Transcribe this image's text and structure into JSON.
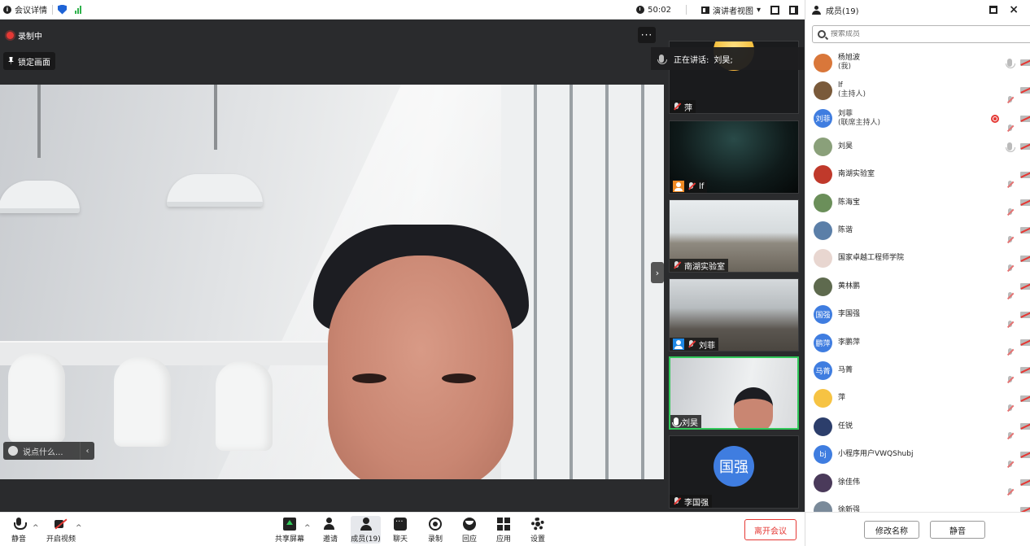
{
  "topbar": {
    "meeting_details": "会议详情",
    "timer": "50:02",
    "view_mode": "演讲者视图"
  },
  "stage": {
    "recording": "录制中",
    "lock_view": "锁定画面",
    "more": "···",
    "chat_placeholder": "说点什么...",
    "speaking_prefix": "正在讲话:",
    "speaking_name": "刘昊;"
  },
  "thumbnails": [
    {
      "name": "萍",
      "type": "cartoon"
    },
    {
      "name": "lf",
      "type": "dark"
    },
    {
      "name": "南湖实验室",
      "type": "room"
    },
    {
      "name": "刘菲",
      "type": "room2"
    },
    {
      "name": "刘昊",
      "type": "self",
      "active": true
    },
    {
      "name": "李国强",
      "type": "avatar",
      "initials": "国强"
    }
  ],
  "toolbar": {
    "mute": "静音",
    "start_video": "开启视频",
    "share_screen": "共享屏幕",
    "invite": "邀请",
    "members": "成员(19)",
    "chat": "聊天",
    "record": "录制",
    "react": "回应",
    "apps": "应用",
    "settings": "设置",
    "leave": "离开会议"
  },
  "panel": {
    "title": "成员(19)",
    "search_placeholder": "搜索成员",
    "rename": "修改名称",
    "mute": "静音",
    "members": [
      {
        "name": "杨旭波",
        "role": "(我)",
        "avatar_color": "#d9773a",
        "initials": ""
      },
      {
        "name": "lf",
        "role": "(主持人)",
        "avatar_color": "#7a5a3a",
        "initials": ""
      },
      {
        "name": "刘菲",
        "role": "(联席主持人)",
        "avatar_color": "#3f7de0",
        "initials": "刘菲",
        "recording": true
      },
      {
        "name": "刘昊",
        "role": "",
        "avatar_color": "#8aa07a",
        "initials": ""
      },
      {
        "name": "南湖实验室",
        "role": "",
        "avatar_color": "#c0392b",
        "initials": ""
      },
      {
        "name": "陈海宝",
        "role": "",
        "avatar_color": "#6b8f5a",
        "initials": ""
      },
      {
        "name": "陈谐",
        "role": "",
        "avatar_color": "#5b7fa8",
        "initials": ""
      },
      {
        "name": "国家卓越工程师学院",
        "role": "",
        "avatar_color": "#e8d6d0",
        "initials": ""
      },
      {
        "name": "黄林鹏",
        "role": "",
        "avatar_color": "#5e6a4e",
        "initials": ""
      },
      {
        "name": "李国强",
        "role": "",
        "avatar_color": "#3f7de0",
        "initials": "国强"
      },
      {
        "name": "李鹏萍",
        "role": "",
        "avatar_color": "#3f7de0",
        "initials": "鹏萍"
      },
      {
        "name": "马菁",
        "role": "",
        "avatar_color": "#3f7de0",
        "initials": "马菁"
      },
      {
        "name": "萍",
        "role": "",
        "avatar_color": "#f6c343",
        "initials": ""
      },
      {
        "name": "任锐",
        "role": "",
        "avatar_color": "#2c3e6b",
        "initials": ""
      },
      {
        "name": "小程序用户VWQShubj",
        "role": "",
        "avatar_color": "#3f7de0",
        "initials": "bj"
      },
      {
        "name": "徐佳伟",
        "role": "",
        "avatar_color": "#4a3a5a",
        "initials": ""
      },
      {
        "name": "徐新强",
        "role": "",
        "avatar_color": "#7a8a9a",
        "initials": ""
      }
    ]
  }
}
